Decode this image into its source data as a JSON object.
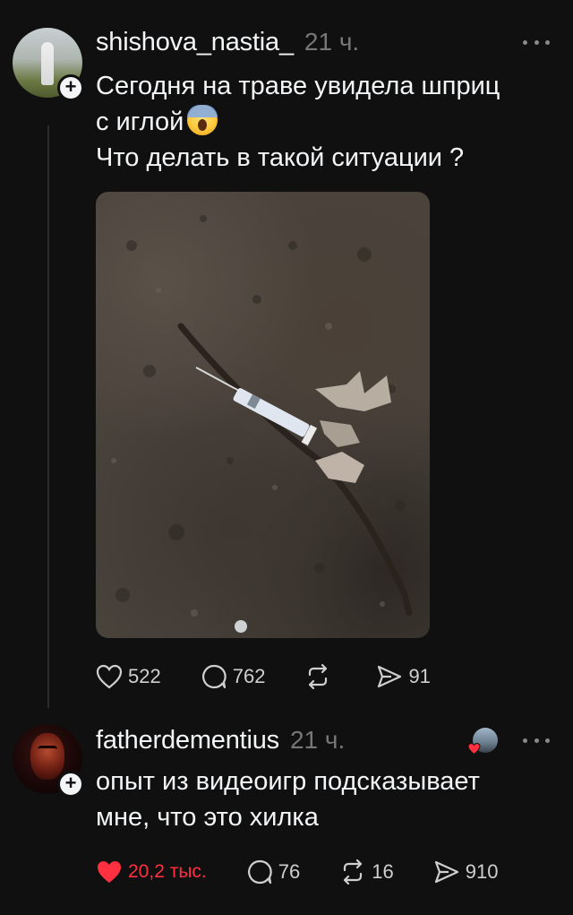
{
  "posts": [
    {
      "username": "shishova_nastia_",
      "time": "21 ч.",
      "text_line1": "Сегодня на траве увидела шприц",
      "text_line2": "с иглой",
      "text_line3": "Что делать в такой ситуации ?",
      "stats": {
        "likes": "522",
        "replies": "762",
        "reposts": "",
        "shares": "91"
      },
      "liked": false
    },
    {
      "username": "fatherdementius",
      "time": "21 ч.",
      "text_line1": "опыт из видеоигр подсказывает",
      "text_line2": "мне, что это хилка",
      "stats": {
        "likes": "20,2 тыс.",
        "replies": "76",
        "reposts": "16",
        "shares": "910"
      },
      "liked": true
    }
  ],
  "icons": {
    "more": "more-dots-icon",
    "like": "heart-icon",
    "reply": "comment-icon",
    "repost": "repost-icon",
    "share": "send-icon",
    "follow": "plus-icon"
  },
  "colors": {
    "background": "#101010",
    "text": "#f3f5f7",
    "muted": "#777777",
    "like_active": "#ff3040"
  }
}
